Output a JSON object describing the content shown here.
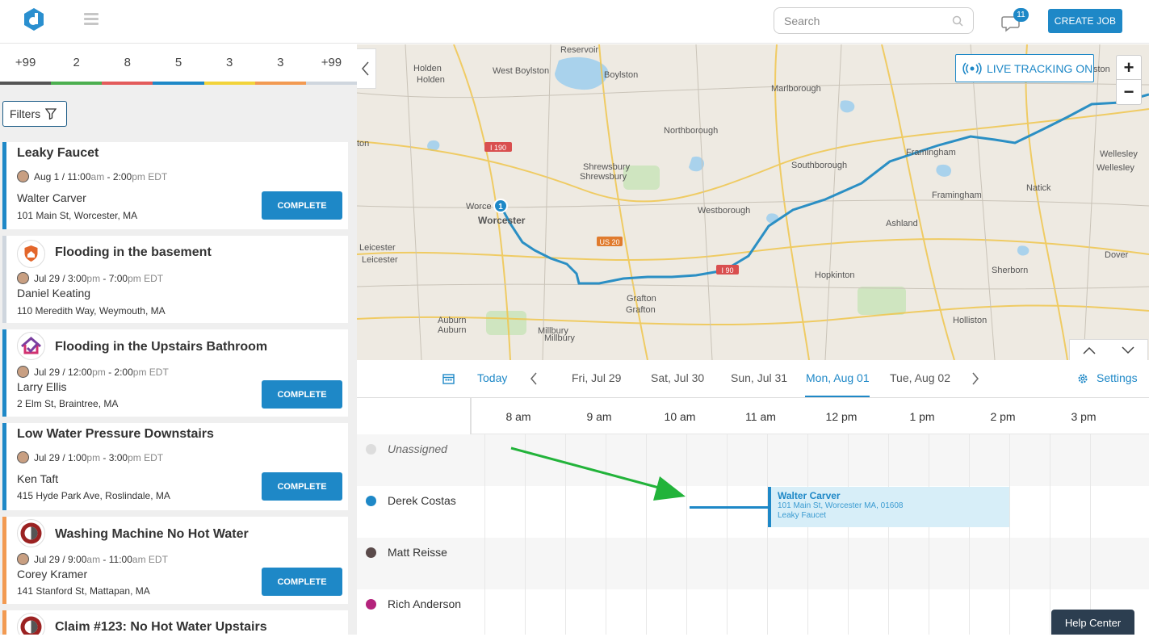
{
  "header": {
    "search_placeholder": "Search",
    "notifications_count": "11",
    "create_job_label": "CREATE JOB"
  },
  "status_counts": [
    {
      "value": "+99",
      "color": "#555555"
    },
    {
      "value": "2",
      "color": "#4caf50"
    },
    {
      "value": "8",
      "color": "#e35b5b"
    },
    {
      "value": "5",
      "color": "#1e88c7"
    },
    {
      "value": "3",
      "color": "#f2d33a"
    },
    {
      "value": "3",
      "color": "#f29a52"
    },
    {
      "value": "+99",
      "color": "#cfd6de"
    }
  ],
  "filters_label": "Filters",
  "jobs": [
    {
      "title": "Leaky Faucet",
      "date": "Aug 1",
      "start": "11:00",
      "start_ampm": "am",
      "end": "2:00",
      "end_ampm": "pm",
      "tz": "EDT",
      "customer": "Walter Carver",
      "address": "101 Main St, Worcester, MA",
      "action": "COMPLETE",
      "color": "#1e88c7",
      "icon": "none"
    },
    {
      "title": "Flooding in the basement",
      "date": "Jul 29",
      "start": "3:00",
      "start_ampm": "pm",
      "end": "7:00",
      "end_ampm": "pm",
      "tz": "EDT",
      "customer": "Daniel Keating",
      "address": "110 Meredith Way, Weymouth, MA",
      "action": "",
      "color": "#cfd6de",
      "icon": "house-shield-icon"
    },
    {
      "title": "Flooding in the Upstairs Bathroom",
      "date": "Jul 29",
      "start": "12:00",
      "start_ampm": "pm",
      "end": "2:00",
      "end_ampm": "pm",
      "tz": "EDT",
      "customer": "Larry Ellis",
      "address": "2 Elm St, Braintree, MA",
      "action": "COMPLETE",
      "color": "#1e88c7",
      "icon": "house-check-icon"
    },
    {
      "title": "Low Water Pressure Downstairs",
      "date": "Jul 29",
      "start": "1:00",
      "start_ampm": "pm",
      "end": "3:00",
      "end_ampm": "pm",
      "tz": "EDT",
      "customer": "Ken Taft",
      "address": "415 Hyde Park Ave, Roslindale, MA",
      "action": "COMPLETE",
      "color": "#1e88c7",
      "icon": "none"
    },
    {
      "title": "Washing Machine No Hot Water",
      "date": "Jul 29",
      "start": "9:00",
      "start_ampm": "am",
      "end": "11:00",
      "end_ampm": "am",
      "tz": "EDT",
      "customer": "Corey Kramer",
      "address": "141 Stanford St, Mattapan, MA",
      "action": "COMPLETE",
      "color": "#f29a52",
      "icon": "brand-circle-icon"
    },
    {
      "title": "Claim #123: No Hot Water Upstairs",
      "color": "#f29a52",
      "icon": "brand-circle-icon"
    }
  ],
  "map": {
    "live_tracking_label": "LIVE TRACKING ON",
    "zoom_in": "+",
    "zoom_out": "−",
    "marker_label": "1",
    "towns": [
      "Reservoir",
      "Holden",
      "Holden",
      "West Boylston",
      "Boylston",
      "Marlborough",
      "Northborough",
      "Shrewsbury",
      "Shrewsbury",
      "Southborough",
      "Framingham",
      "Framingham",
      "Natick",
      "Wellesley",
      "Wellesley",
      "Worce",
      "Worcester",
      "Westborough",
      "Ashland",
      "Leicester",
      "Leicester",
      "Hopkinton",
      "Sherborn",
      "Dover",
      "Grafton",
      "Grafton",
      "Auburn",
      "Auburn",
      "Millbury",
      "Millbury",
      "Holliston",
      "ton",
      "ston"
    ],
    "roads": [
      "I 190",
      "US 20",
      "I 90"
    ]
  },
  "schedule": {
    "today_label": "Today",
    "days": [
      "Fri, Jul 29",
      "Sat, Jul 30",
      "Sun, Jul 31",
      "Mon, Aug 01",
      "Tue, Aug 02"
    ],
    "active_day": "Mon, Aug 01",
    "settings_label": "Settings",
    "hours": [
      "8 am",
      "9 am",
      "10 am",
      "11 am",
      "12 pm",
      "1 pm",
      "2 pm",
      "3 pm"
    ],
    "technicians": [
      {
        "name": "Unassigned",
        "color": "#dddddd"
      },
      {
        "name": "Derek Costas",
        "color": "#1e88c7"
      },
      {
        "name": "Matt Reisse",
        "color": "#5a4a4a"
      },
      {
        "name": "Rich Anderson",
        "color": "#b4237c"
      }
    ],
    "event": {
      "customer": "Walter Carver",
      "address": "101 Main St, Worcester MA, 01608",
      "job": "Leaky Faucet"
    }
  },
  "help_center_label": "Help Center"
}
